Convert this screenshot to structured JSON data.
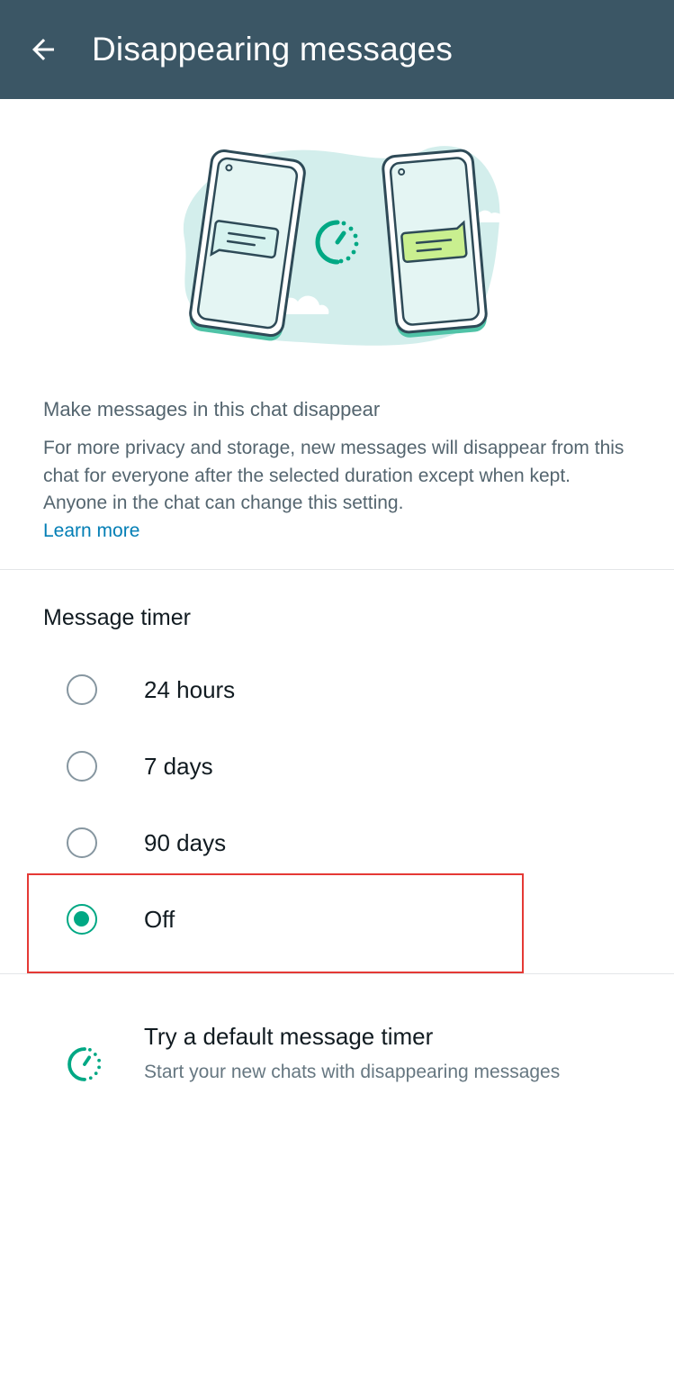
{
  "header": {
    "title": "Disappearing messages",
    "back_icon": "arrow-left-icon",
    "background_color": "#3b5665"
  },
  "intro": {
    "heading": "Make messages in this chat disappear",
    "body": "For more privacy and storage, new messages will disappear from this chat for everyone after the selected duration except when kept. Anyone in the chat can change this setting.",
    "learn_more": "Learn more"
  },
  "timer": {
    "title": "Message timer",
    "options": [
      {
        "label": "24 hours",
        "selected": false
      },
      {
        "label": "7 days",
        "selected": false
      },
      {
        "label": "90 days",
        "selected": false
      },
      {
        "label": "Off",
        "selected": true
      }
    ]
  },
  "default_timer": {
    "title": "Try a default message timer",
    "subtitle": "Start your new chats with disappearing messages",
    "icon": "timer-icon"
  },
  "colors": {
    "accent": "#00a884",
    "link": "#027eb5",
    "highlight": "#e53935"
  }
}
